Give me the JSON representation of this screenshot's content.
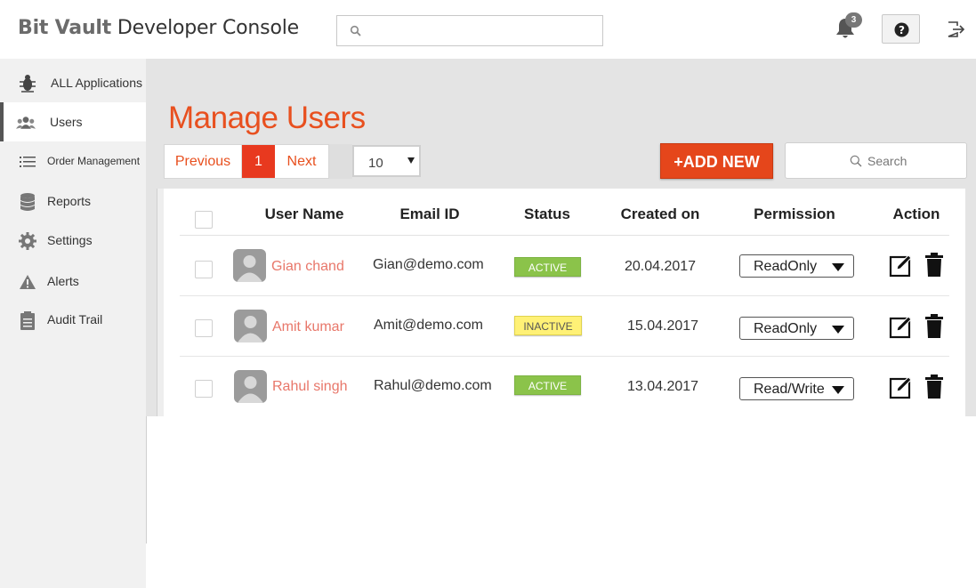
{
  "header": {
    "brand_part1": "Bit Vault",
    "brand_part2": "Developer Console",
    "search_placeholder": "",
    "notification_count": "3"
  },
  "sidebar": {
    "items": [
      {
        "label": "ALL Applications",
        "icon": "bug-icon"
      },
      {
        "label": "Users",
        "icon": "users-icon",
        "active": true
      },
      {
        "label": "Order Management",
        "icon": "list-icon"
      },
      {
        "label": "Reports",
        "icon": "database-icon"
      },
      {
        "label": "Settings",
        "icon": "gear-icon"
      },
      {
        "label": "Alerts",
        "icon": "warning-icon"
      },
      {
        "label": "Audit Trail",
        "icon": "clipboard-icon"
      }
    ]
  },
  "main": {
    "title": "Manage Users",
    "pager": {
      "previous": "Previous",
      "current": "1",
      "next": "Next"
    },
    "per_page": "10",
    "add_button": "+ADD NEW",
    "search_placeholder": "Search"
  },
  "table": {
    "columns": [
      "User Name",
      "Email ID",
      "Status",
      "Created on",
      "Permission",
      "Action"
    ],
    "rows": [
      {
        "name": "Gian chand",
        "email": "Gian@demo.com",
        "status": "ACTIVE",
        "created": "20.04.2017",
        "permission": "ReadOnly"
      },
      {
        "name": "Amit kumar",
        "email": "Amit@demo.com",
        "status": "INACTIVE",
        "created": "15.04.2017",
        "permission": "ReadOnly"
      },
      {
        "name": "Rahul singh",
        "email": "Rahul@demo.com",
        "status": "ACTIVE",
        "created": "13.04.2017",
        "permission": "Read/Write"
      }
    ]
  },
  "colors": {
    "accent": "#e8501f",
    "active_status": "#8bc34a",
    "inactive_status": "#fff176",
    "username": "#e8776a"
  }
}
